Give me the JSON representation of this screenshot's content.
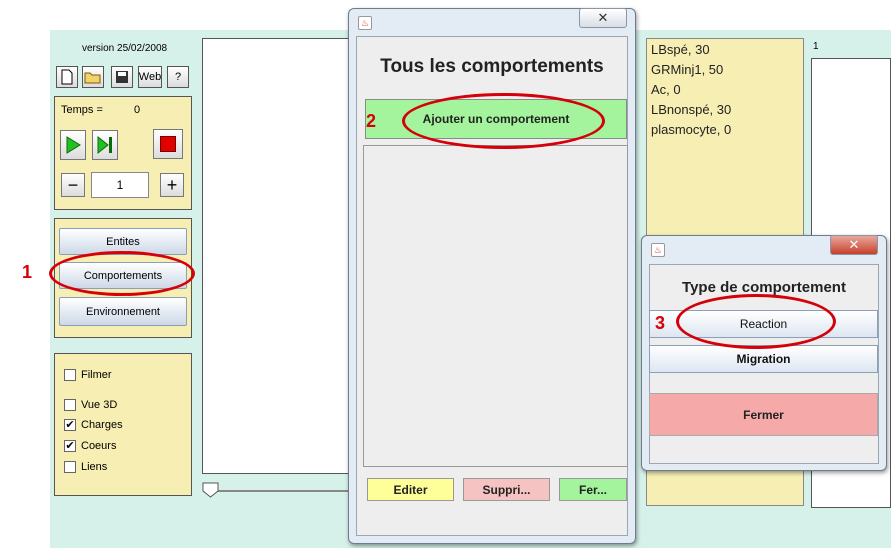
{
  "app": {
    "version": "version 25/02/2008",
    "toolbar": {
      "web_label": "Web",
      "help_label": "?"
    },
    "temps_label": "Temps =",
    "temps_value": "0",
    "step_value": "1",
    "minus_label": "−",
    "plus_label": "+",
    "nav": {
      "entites": "Entites",
      "comportements": "Comportements",
      "environnement": "Environnement"
    },
    "options": [
      {
        "label": "Filmer",
        "checked": false
      },
      {
        "label": "Vue 3D",
        "checked": false
      },
      {
        "label": "Charges",
        "checked": true
      },
      {
        "label": "Coeurs",
        "checked": true
      },
      {
        "label": "Liens",
        "checked": false
      }
    ],
    "data_list": [
      "LBspé, 30",
      "GRMinj1, 50",
      "Ac, 0",
      "LBnonspé, 30",
      "plasmocyte, 0"
    ],
    "right_panel_index": "1"
  },
  "dialog_all": {
    "title": "Tous les comportements",
    "add_button": "Ajouter un comportement",
    "edit_button": "Editer",
    "delete_button": "Suppri...",
    "close_button": "Fer..."
  },
  "dialog_type": {
    "title": "Type de comportement",
    "reaction_button": "Reaction",
    "migration_button": "Migration",
    "close_button": "Fermer"
  },
  "annotations": {
    "step1": "1",
    "step2": "2",
    "step3": "3"
  },
  "colors": {
    "app_bg": "#d6f0ea",
    "panel_yellow": "#f7eeb4",
    "highlight_red": "#d6000b",
    "add_green": "#a4f49e",
    "close_pink": "#f6a9a9"
  }
}
